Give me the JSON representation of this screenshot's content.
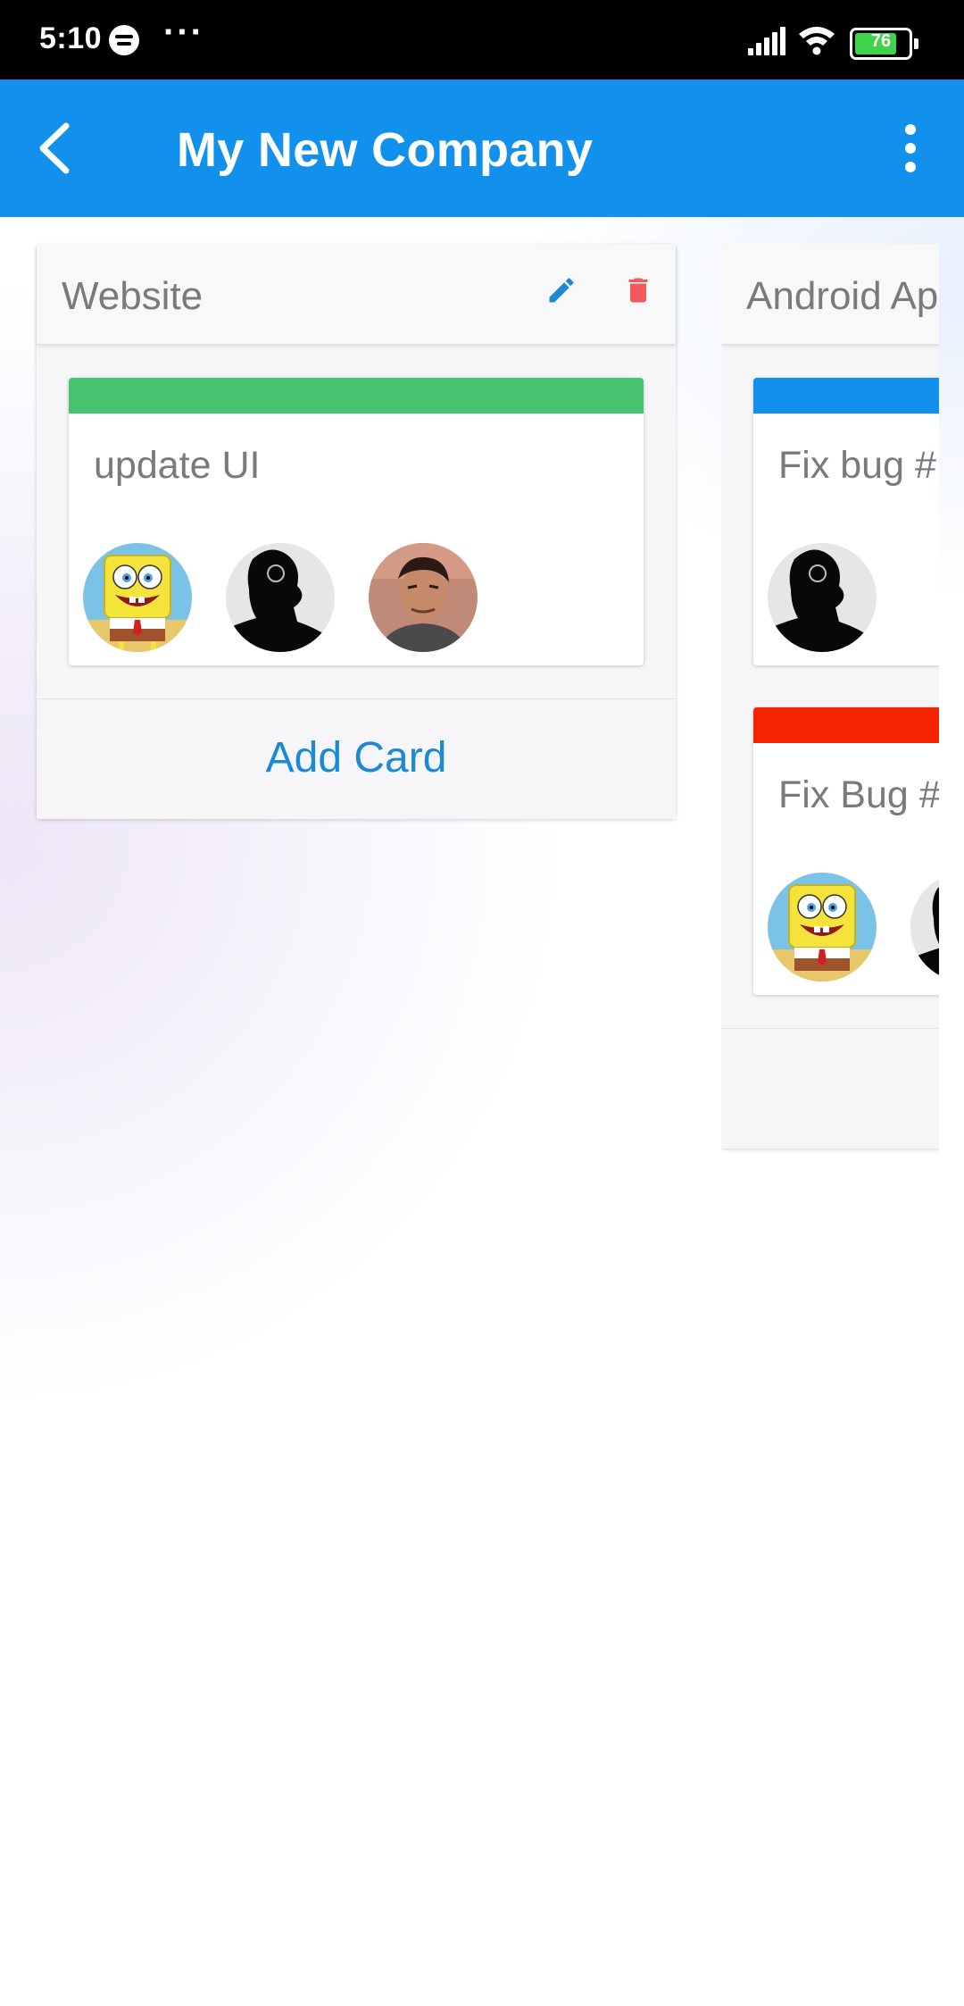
{
  "status_bar": {
    "time": "5:10",
    "icons": [
      "spotify-icon",
      "more-dots",
      "signal-icon",
      "wifi-icon",
      "battery-icon"
    ],
    "dots": "···",
    "battery_level": "76"
  },
  "app_bar": {
    "title": "My New Company",
    "back_icon": "back-arrow-icon",
    "menu_icon": "more-vert-icon",
    "color": "#1190ec"
  },
  "lists": [
    {
      "title": "Website",
      "edit_icon": "pencil-icon",
      "delete_icon": "trash-icon",
      "cards": [
        {
          "title": "update UI",
          "label_color": "#47c46f",
          "members": [
            "spongebob-avatar",
            "silhouette-avatar",
            "photo-avatar"
          ]
        }
      ],
      "add_card_label": "Add Card"
    },
    {
      "title": "Android Ap",
      "cards": [
        {
          "title": "Fix bug #",
          "label_color": "#1190ec",
          "members": [
            "silhouette-avatar"
          ]
        },
        {
          "title": "Fix Bug #",
          "label_color": "#f52300",
          "members": [
            "spongebob-avatar",
            "silhouette-avatar"
          ]
        }
      ]
    }
  ],
  "colors": {
    "accent": "#1190ec",
    "delete": "#f05a5a",
    "add_card_text": "#1a8ad6"
  }
}
